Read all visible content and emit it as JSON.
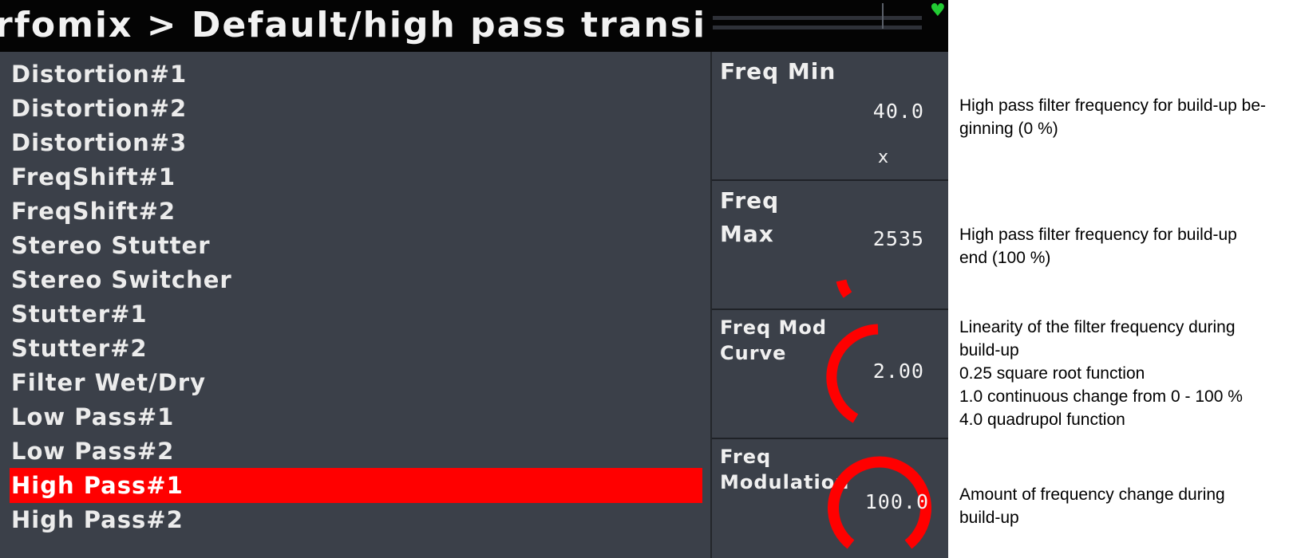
{
  "header": {
    "title": "rfomix > Default/high pass transi"
  },
  "effects_list": {
    "items": [
      {
        "label": "Distortion#1",
        "selected": false
      },
      {
        "label": "Distortion#2",
        "selected": false
      },
      {
        "label": "Distortion#3",
        "selected": false
      },
      {
        "label": "FreqShift#1",
        "selected": false
      },
      {
        "label": "FreqShift#2",
        "selected": false
      },
      {
        "label": "Stereo Stutter",
        "selected": false
      },
      {
        "label": "Stereo Switcher",
        "selected": false
      },
      {
        "label": "Stutter#1",
        "selected": false
      },
      {
        "label": "Stutter#2",
        "selected": false
      },
      {
        "label": "Filter Wet/Dry",
        "selected": false
      },
      {
        "label": "Low Pass#1",
        "selected": false
      },
      {
        "label": "Low Pass#2",
        "selected": false
      },
      {
        "label": "High Pass#1",
        "selected": true
      },
      {
        "label": "High Pass#2",
        "selected": false
      }
    ]
  },
  "params": [
    {
      "label_lines": [
        "Freq Min"
      ],
      "value": "40.0",
      "unit": "x"
    },
    {
      "label_lines": [
        "Freq",
        "Max"
      ],
      "value": "2535"
    },
    {
      "label_lines": [
        "Freq Mod",
        "Curve"
      ],
      "value": "2.00"
    },
    {
      "label_lines": [
        "Freq",
        "Modulation"
      ],
      "value": "100.0"
    }
  ],
  "annotations": [
    {
      "lines": [
        "High pass filter frequency for build-up be-",
        "ginning (0 %)"
      ]
    },
    {
      "lines": [
        "High pass filter frequency for build-up",
        "end (100 %)"
      ]
    },
    {
      "lines": [
        "Linearity of the filter frequency during",
        "build-up",
        "0.25 square root function",
        "1.0 continuous change from 0 - 100 %",
        "4.0 quadrupol function"
      ]
    },
    {
      "lines": [
        "Amount of frequency change during",
        "build-up"
      ]
    }
  ],
  "colors": {
    "accent": "#ff0000",
    "panel_bg": "#3b4049",
    "titlebar_bg": "#040404",
    "status_ok": "#22cc33"
  },
  "icons": {
    "status": "heart-icon"
  }
}
